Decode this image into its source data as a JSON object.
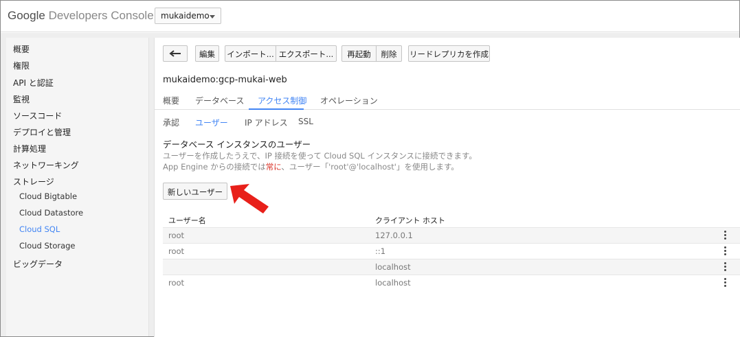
{
  "header": {
    "logo_google": "Google",
    "logo_product": "Developers Console",
    "project": "mukaidemo"
  },
  "sidebar": {
    "items": [
      {
        "label": "概要"
      },
      {
        "label": "権限"
      },
      {
        "label": "API と認証"
      },
      {
        "label": "監視"
      },
      {
        "label": "ソースコード"
      },
      {
        "label": "デプロイと管理"
      },
      {
        "label": "計算処理"
      },
      {
        "label": "ネットワーキング"
      },
      {
        "label": "ストレージ"
      },
      {
        "label": "Cloud Bigtable"
      },
      {
        "label": "Cloud Datastore"
      },
      {
        "label": "Cloud SQL"
      },
      {
        "label": "Cloud Storage"
      },
      {
        "label": "ビッグデータ"
      }
    ]
  },
  "toolbar": {
    "edit": "編集",
    "import": "インポート...",
    "export": "エクスポート...",
    "restart": "再起動",
    "delete": "削除",
    "create_replica": "リードレプリカを作成"
  },
  "instance": {
    "title": "mukaidemo:gcp-mukai-web"
  },
  "tabs": [
    {
      "label": "概要"
    },
    {
      "label": "データベース"
    },
    {
      "label": "アクセス制御"
    },
    {
      "label": "オペレーション"
    }
  ],
  "subtabs": [
    {
      "label": "承認"
    },
    {
      "label": "ユーザー"
    },
    {
      "label": "IP アドレス"
    },
    {
      "label": "SSL"
    }
  ],
  "users_section": {
    "title": "データベース インスタンスのユーザー",
    "desc1": "ユーザーを作成したうえで、IP 接続を使って Cloud SQL インスタンスに接続できます。",
    "desc2_a": "App Engine からの接続では",
    "desc2_red": "常に",
    "desc2_b": "、ユーザー「'root'@'localhost'」を使用します。",
    "new_user": "新しいユーザー"
  },
  "table": {
    "headers": {
      "name": "ユーザー名",
      "host": "クライアント ホスト"
    },
    "rows": [
      {
        "name": "root",
        "host": "127.0.0.1"
      },
      {
        "name": "root",
        "host": "::1"
      },
      {
        "name": "",
        "host": "localhost"
      },
      {
        "name": "root",
        "host": "localhost"
      }
    ]
  },
  "colors": {
    "accent": "#4285f4",
    "annotation_arrow": "#e8201a",
    "warning_text": "#d93025"
  },
  "icons": {
    "back": "back-arrow-icon",
    "dropdown": "chevron-down-icon",
    "row_menu": "more-vert-icon",
    "annotation": "red-arrow-annotation"
  }
}
